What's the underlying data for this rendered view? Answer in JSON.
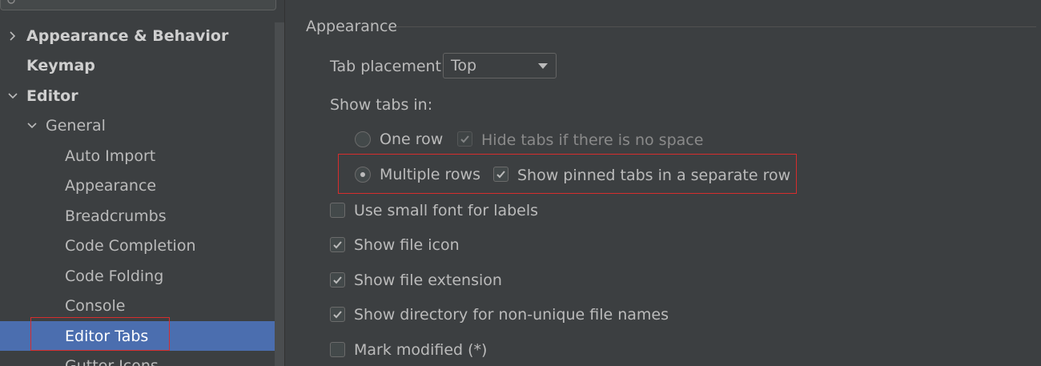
{
  "sidebar": {
    "items": [
      {
        "label": "Appearance & Behavior"
      },
      {
        "label": "Keymap"
      },
      {
        "label": "Editor"
      },
      {
        "label": "General"
      },
      {
        "label": "Auto Import"
      },
      {
        "label": "Appearance"
      },
      {
        "label": "Breadcrumbs"
      },
      {
        "label": "Code Completion"
      },
      {
        "label": "Code Folding"
      },
      {
        "label": "Console"
      },
      {
        "label": "Editor Tabs"
      },
      {
        "label": "Gutter Icons"
      }
    ],
    "selected": "Editor Tabs"
  },
  "main": {
    "section_title": "Appearance",
    "tab_placement": {
      "label": "Tab placement:",
      "value": "Top"
    },
    "show_tabs_in": {
      "label": "Show tabs in:",
      "one_row": {
        "label": "One row",
        "selected": false
      },
      "hide_tabs": {
        "label": "Hide tabs if there is no space",
        "checked": true,
        "enabled": false
      },
      "multiple_rows": {
        "label": "Multiple rows",
        "selected": true
      },
      "show_pinned": {
        "label": "Show pinned tabs in a separate row",
        "checked": true
      }
    },
    "options": [
      {
        "label": "Use small font for labels",
        "checked": false
      },
      {
        "label": "Show file icon",
        "checked": true
      },
      {
        "label": "Show file extension",
        "checked": true
      },
      {
        "label": "Show directory for non-unique file names",
        "checked": true
      },
      {
        "label": "Mark modified (*)",
        "checked": false
      }
    ]
  },
  "colors": {
    "background": "#3c3f41",
    "selection": "#4b6eaf",
    "text": "#bbbbbb",
    "highlight_box": "#d62d2d"
  }
}
